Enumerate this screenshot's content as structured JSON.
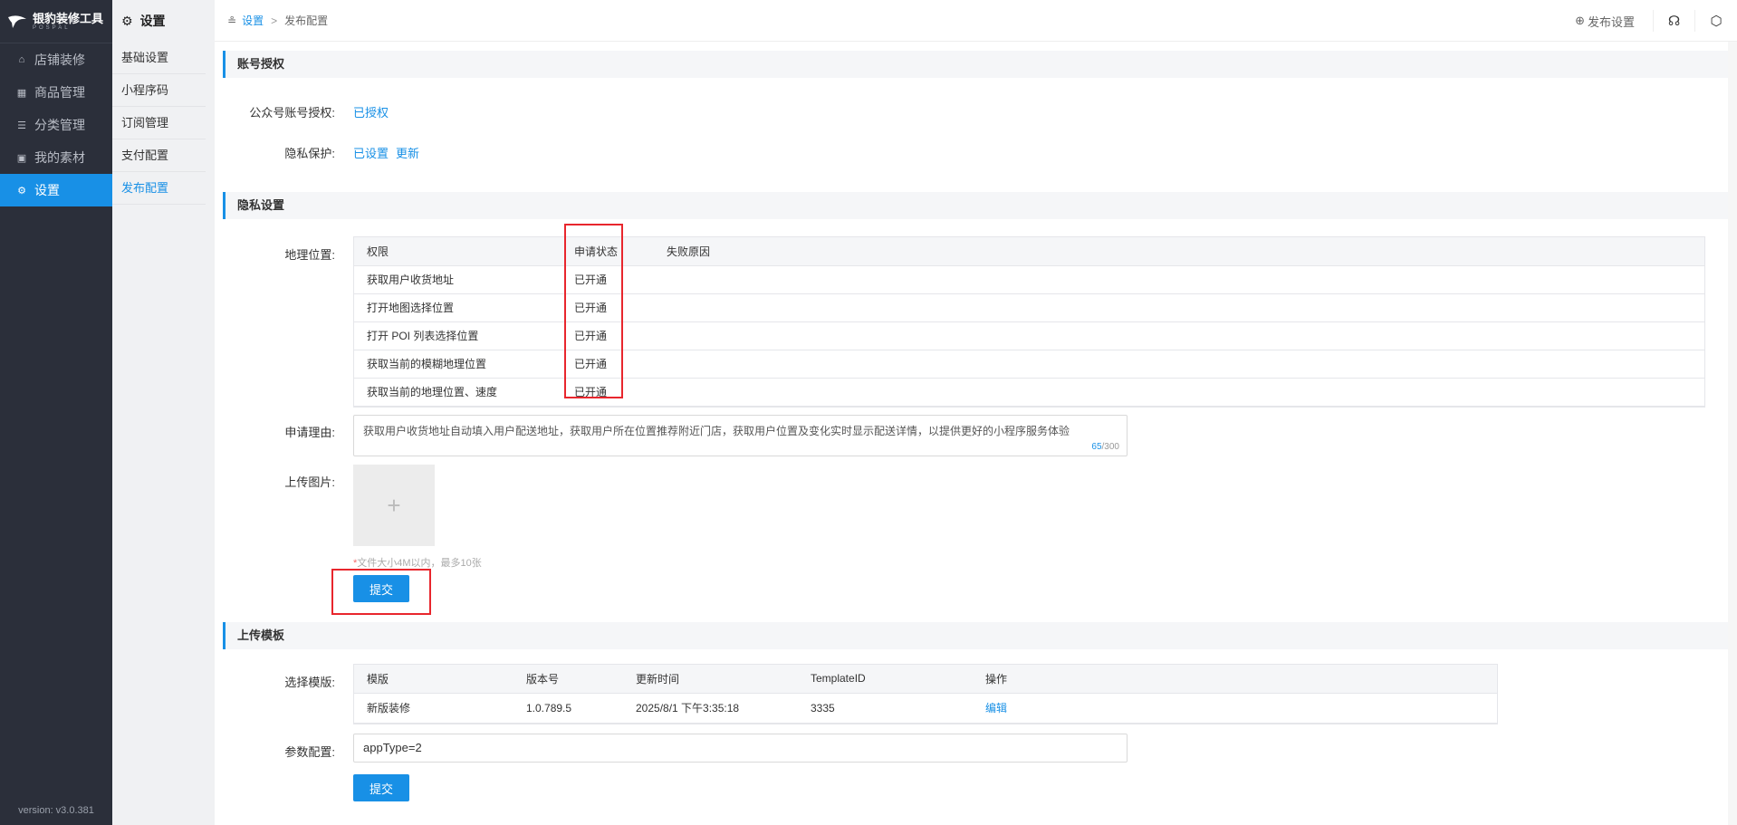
{
  "brand": {
    "name": "银豹装修工具",
    "sub": "POSPAL",
    "version": "version: v3.0.381"
  },
  "sidebar": {
    "items": [
      {
        "label": "店铺装修",
        "icon": "store-icon"
      },
      {
        "label": "商品管理",
        "icon": "grid-icon"
      },
      {
        "label": "分类管理",
        "icon": "list-icon"
      },
      {
        "label": "我的素材",
        "icon": "image-icon"
      },
      {
        "label": "设置",
        "icon": "gear-icon",
        "active": true
      }
    ]
  },
  "subnav": {
    "title": "设置",
    "items": [
      "基础设置",
      "小程序码",
      "订阅管理",
      "支付配置",
      "发布配置"
    ]
  },
  "breadcrumb": {
    "root": "设置",
    "sep": ">",
    "current": "发布配置"
  },
  "topbar": {
    "publish_label": "发布设置"
  },
  "account": {
    "title": "账号授权",
    "mp_label": "公众号账号授权:",
    "mp_value": "已授权",
    "privacy_label": "隐私保护:",
    "privacy_value": "已设置",
    "privacy_update": "更新"
  },
  "privacy": {
    "title": "隐私设置",
    "location_label": "地理位置:",
    "columns": [
      "权限",
      "申请状态",
      "失败原因"
    ],
    "rows": [
      {
        "perm": "获取用户收货地址",
        "status": "已开通",
        "reason": ""
      },
      {
        "perm": "打开地图选择位置",
        "status": "已开通",
        "reason": ""
      },
      {
        "perm": "打开 POI 列表选择位置",
        "status": "已开通",
        "reason": ""
      },
      {
        "perm": "获取当前的模糊地理位置",
        "status": "已开通",
        "reason": ""
      },
      {
        "perm": "获取当前的地理位置、速度",
        "status": "已开通",
        "reason": ""
      }
    ],
    "reason_label": "申请理由:",
    "reason_text": "获取用户收货地址自动填入用户配送地址，获取用户所在位置推荐附近门店，获取用户位置及变化实时显示配送详情，以提供更好的小程序服务体验",
    "reason_count": "65",
    "reason_max": "/300",
    "upload_label": "上传图片:",
    "upload_hint": "文件大小4M以内，最多10张",
    "submit": "提交"
  },
  "template": {
    "title": "上传模板",
    "select_label": "选择模版:",
    "columns": [
      "模版",
      "版本号",
      "更新时间",
      "TemplateID",
      "操作"
    ],
    "rows": [
      {
        "name": "新版装修",
        "version": "1.0.789.5",
        "time": "2025/8/1 下午3:35:18",
        "id": "3335",
        "action": "编辑"
      }
    ],
    "param_label": "参数配置:",
    "param_value": "appType=2",
    "submit": "提交"
  }
}
